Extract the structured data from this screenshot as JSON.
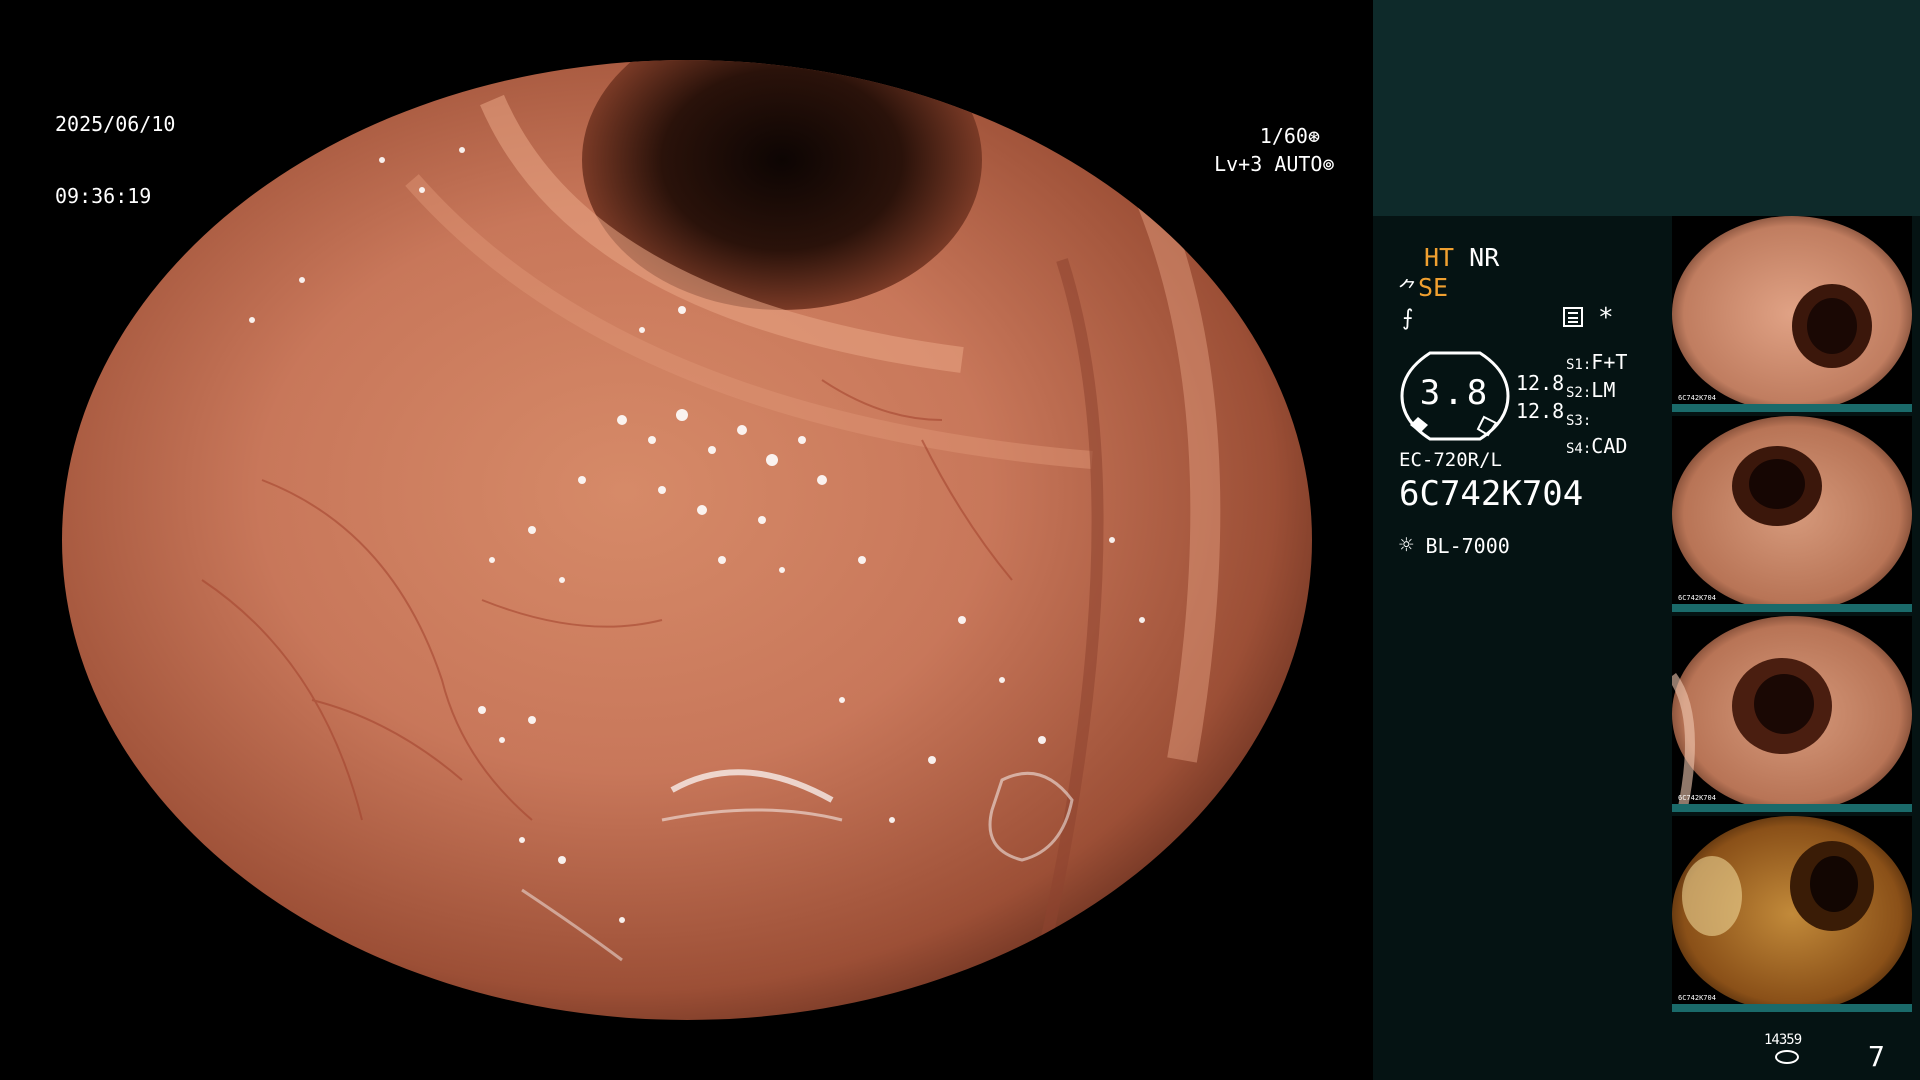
{
  "overlay": {
    "date": "2025/06/10",
    "time": "09:36:19",
    "shutter": "1/60",
    "level": "Lv+3",
    "exposure_mode": "AUTO"
  },
  "panel": {
    "mode_ht": "HT",
    "mode_nr": "NR",
    "mode_se": "SE",
    "star": "*",
    "ring_value": "3.8",
    "value_top": "12.8",
    "value_bottom": "12.8",
    "switches": [
      {
        "key": "S1:",
        "value": "F+T"
      },
      {
        "key": "S2:",
        "value": "LM"
      },
      {
        "key": "S3:",
        "value": ""
      },
      {
        "key": "S4:",
        "value": "CAD"
      }
    ],
    "scope_model": "EC-720R/L",
    "scope_serial": "6C742K704",
    "light_source": "BL-7000",
    "storage_count": "14359",
    "image_count": "7"
  },
  "thumbnails": [
    {
      "caption": "6C742K704"
    },
    {
      "caption": "6C742K704"
    },
    {
      "caption": "6C742K704"
    },
    {
      "caption": "6C742K704"
    }
  ],
  "colors": {
    "mucosa": "#c8775a",
    "lumen": "#1e0c06",
    "accent_orange": "#f0a030",
    "panel_bg": "#051313",
    "panel_top": "#0e2a2a"
  }
}
